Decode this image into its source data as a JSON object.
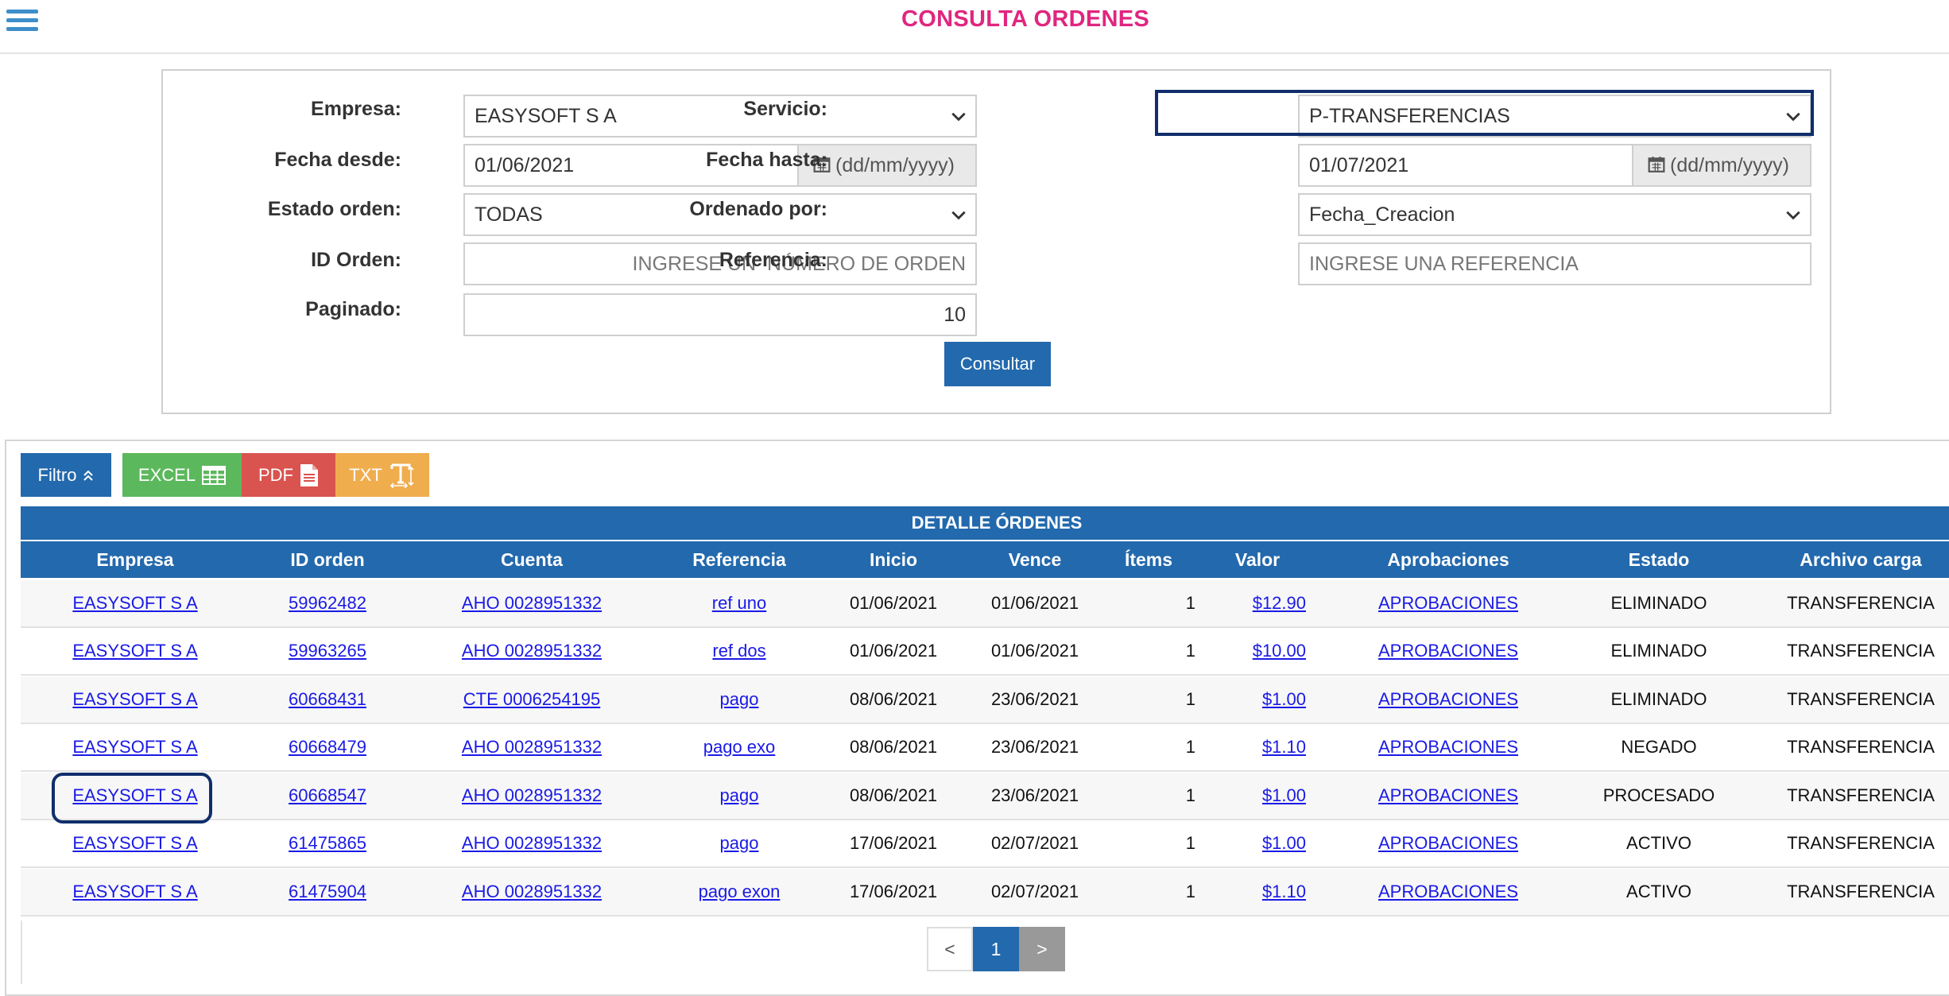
{
  "header": {
    "title": "CONSULTA ORDENES",
    "menu_icon": "hamburger-icon"
  },
  "filters": {
    "empresa": {
      "label": "Empresa:",
      "value": "EASYSOFT S A"
    },
    "fecha_desde": {
      "label": "Fecha desde:",
      "value": "01/06/2021",
      "format_hint": "(dd/mm/yyyy)"
    },
    "estado_orden": {
      "label": "Estado orden:",
      "value": "TODAS"
    },
    "id_orden": {
      "label": "ID Orden:",
      "placeholder": "INGRESE UN  NÚMERO DE ORDEN"
    },
    "paginado": {
      "label": "Paginado:",
      "value": "10"
    },
    "servicio": {
      "label": "Servicio:",
      "value": "P-TRANSFERENCIAS"
    },
    "fecha_hasta": {
      "label": "Fecha hasta:",
      "value": "01/07/2021",
      "format_hint": "(dd/mm/yyyy)"
    },
    "ordenado_por": {
      "label": "Ordenado por:",
      "value": "Fecha_Creacion"
    },
    "referencia": {
      "label": "Referencia:",
      "placeholder": "INGRESE UNA REFERENCIA"
    },
    "consultar_label": "Consultar"
  },
  "toolbar": {
    "filtro": "Filtro",
    "excel": "EXCEL",
    "pdf": "PDF",
    "txt": "TXT"
  },
  "table": {
    "title": "DETALLE ÓRDENES",
    "columns": [
      "Empresa",
      "ID orden",
      "Cuenta",
      "Referencia",
      "Inicio",
      "Vence",
      "Ítems",
      "Valor",
      "Aprobaciones",
      "Estado",
      "Archivo carga"
    ],
    "rows": [
      [
        "EASYSOFT S A",
        "59962482",
        "AHO 0028951332",
        "ref uno",
        "01/06/2021",
        "01/06/2021",
        "1",
        "$12.90",
        "APROBACIONES",
        "ELIMINADO",
        "TRANSFERENCIA"
      ],
      [
        "EASYSOFT S A",
        "59963265",
        "AHO 0028951332",
        "ref dos",
        "01/06/2021",
        "01/06/2021",
        "1",
        "$10.00",
        "APROBACIONES",
        "ELIMINADO",
        "TRANSFERENCIA"
      ],
      [
        "EASYSOFT S A",
        "60668431",
        "CTE 0006254195",
        "pago",
        "08/06/2021",
        "23/06/2021",
        "1",
        "$1.00",
        "APROBACIONES",
        "ELIMINADO",
        "TRANSFERENCIA"
      ],
      [
        "EASYSOFT S A",
        "60668479",
        "AHO 0028951332",
        "pago exo",
        "08/06/2021",
        "23/06/2021",
        "1",
        "$1.10",
        "APROBACIONES",
        "NEGADO",
        "TRANSFERENCIA"
      ],
      [
        "EASYSOFT S A",
        "60668547",
        "AHO 0028951332",
        "pago",
        "08/06/2021",
        "23/06/2021",
        "1",
        "$1.00",
        "APROBACIONES",
        "PROCESADO",
        "TRANSFERENCIA"
      ],
      [
        "EASYSOFT S A",
        "61475865",
        "AHO 0028951332",
        "pago",
        "17/06/2021",
        "02/07/2021",
        "1",
        "$1.00",
        "APROBACIONES",
        "ACTIVO",
        "TRANSFERENCIA"
      ],
      [
        "EASYSOFT S A",
        "61475904",
        "AHO 0028951332",
        "pago exon",
        "17/06/2021",
        "02/07/2021",
        "1",
        "$1.10",
        "APROBACIONES",
        "ACTIVO",
        "TRANSFERENCIA"
      ]
    ]
  },
  "pagination": {
    "prev": "<",
    "current": "1",
    "next": ">"
  },
  "colors": {
    "title": "#e0267f",
    "primary": "#2369ad",
    "excel": "#5cb85c",
    "pdf": "#d9534f",
    "txt": "#f0ad4e",
    "highlight": "#102e6b",
    "link": "#1a1ae6"
  }
}
